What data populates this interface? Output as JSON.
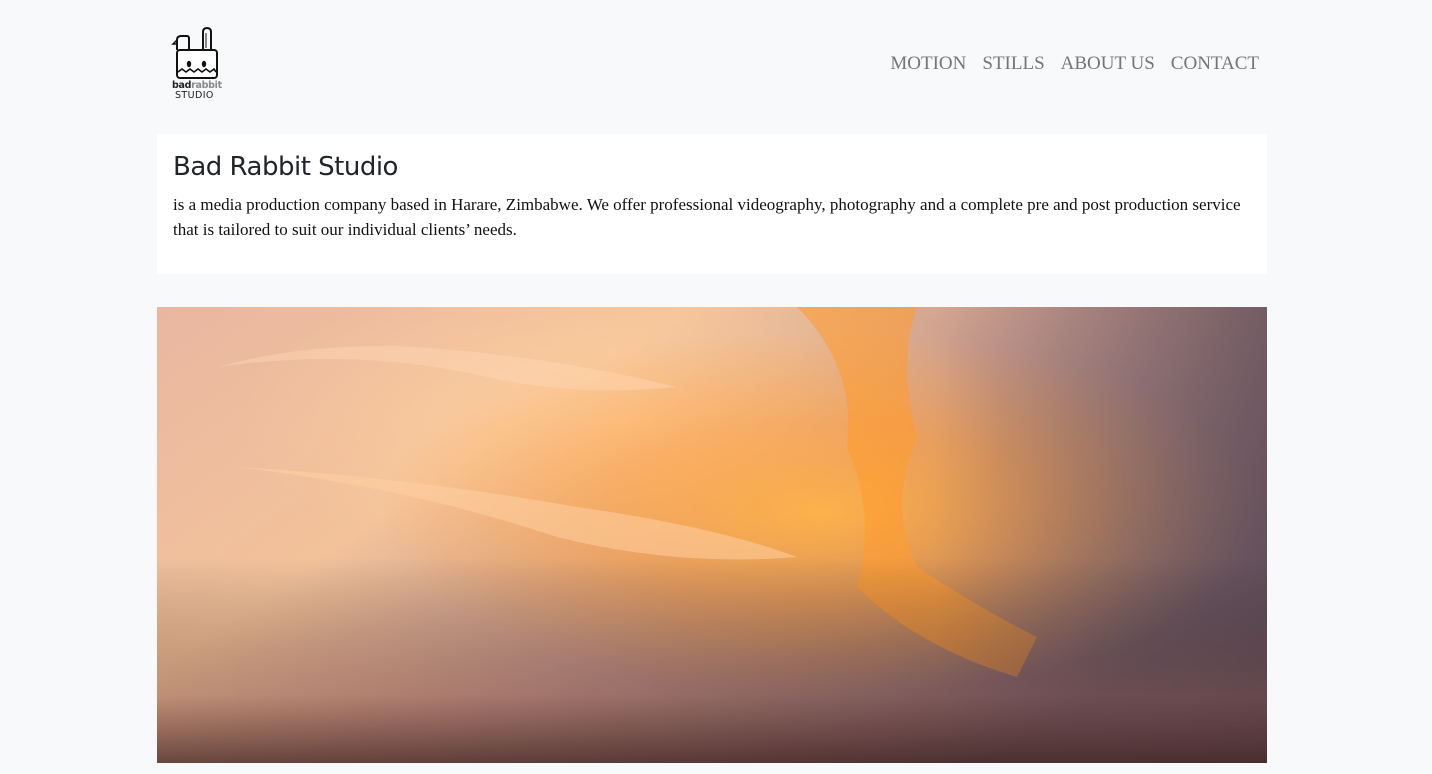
{
  "header": {
    "logo": {
      "brand_word_1": "bad",
      "brand_word_2": "rabbit",
      "brand_word_3": "STUDIO",
      "icon": "rabbit-logo-icon"
    },
    "nav": [
      {
        "label": "MOTION"
      },
      {
        "label": "STILLS"
      },
      {
        "label": "ABOUT US"
      },
      {
        "label": "CONTACT"
      }
    ]
  },
  "intro": {
    "title": "Bad Rabbit Studio",
    "description": "is a media production company based in Harare, Zimbabwe. We offer professional videography, photography and a complete pre and post production service that is tailored to suit our individual clients’ needs."
  },
  "hero": {
    "image": "sunset-sky-clouds-photo"
  },
  "colors": {
    "page_bg": "#f8f9fa",
    "card_bg": "#ffffff",
    "nav_text": "#757575",
    "title_text": "#212529"
  }
}
